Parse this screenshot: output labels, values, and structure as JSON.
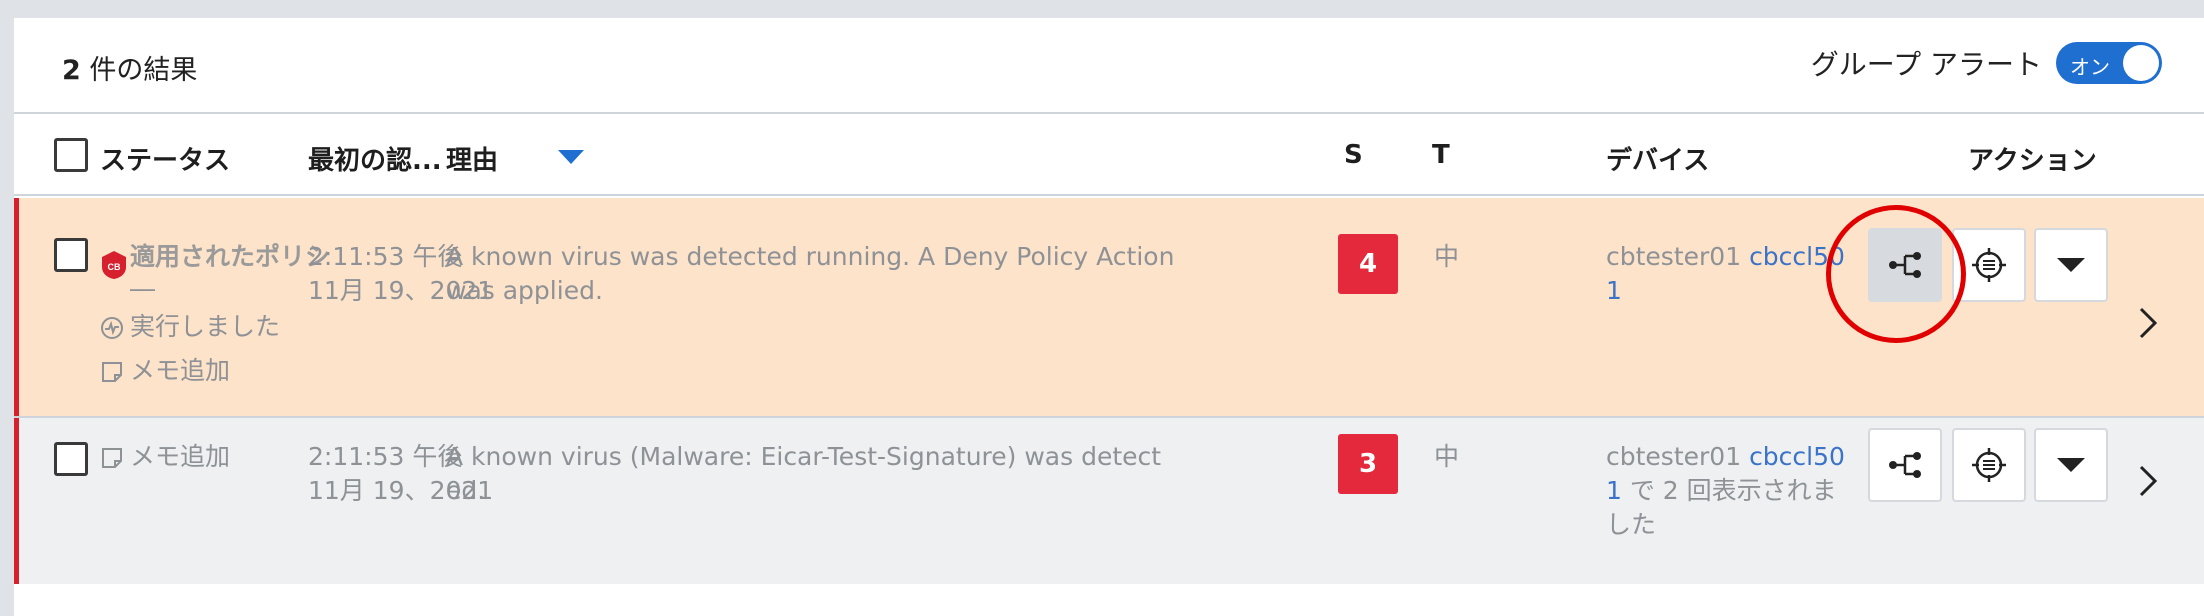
{
  "results": {
    "count": "2",
    "suffix": " 件の結果"
  },
  "group_alert": {
    "label": "グループ アラート",
    "toggle_text": "オン",
    "state": "on"
  },
  "columns": {
    "status": "ステータス",
    "first_seen": "最初の認...",
    "reason": "理由",
    "severity": "S",
    "type": "T",
    "device": "デバイス",
    "actions": "アクション"
  },
  "rows": [
    {
      "status_title_line1": "適用されたポリシ",
      "status_title_line2": "―",
      "status_line2": "実行しました",
      "memo": "メモ追加",
      "time": "2:11:53 午後",
      "date": "11月 19、2021",
      "reason_line1": "A known virus was detected running. A Deny Policy Action",
      "reason_line2": "was applied.",
      "severity": "4",
      "type": "中",
      "device_name": "cbtester01",
      "device_link_part1": "cbccl50",
      "device_link_part2": "1"
    },
    {
      "memo": "メモ追加",
      "time": "2:11:53 午後",
      "date": "11月 19、2021",
      "reason_line1": "A known virus (Malware: Eicar-Test-Signature) was detect",
      "reason_line2": "ed.",
      "severity": "3",
      "type": "中",
      "device_name": "cbtester01",
      "device_link_part1": "cbccl50",
      "device_link_part2": "1",
      "device_suffix": " で 2 回表示されま",
      "device_suffix2": "した"
    }
  ],
  "icons": {
    "cb_badge": "cb-shield-icon",
    "run": "activity-icon",
    "memo": "note-icon",
    "process_tree": "process-tree-icon",
    "investigate": "crosshair-icon",
    "more": "caret-down-icon",
    "expand": "chevron-right-icon"
  },
  "colors": {
    "accent": "#1f6fd1",
    "severity": "#e5293d",
    "row_highlight": "#fde3c9",
    "stripe": "#d6202e",
    "annotation": "#e00000"
  }
}
